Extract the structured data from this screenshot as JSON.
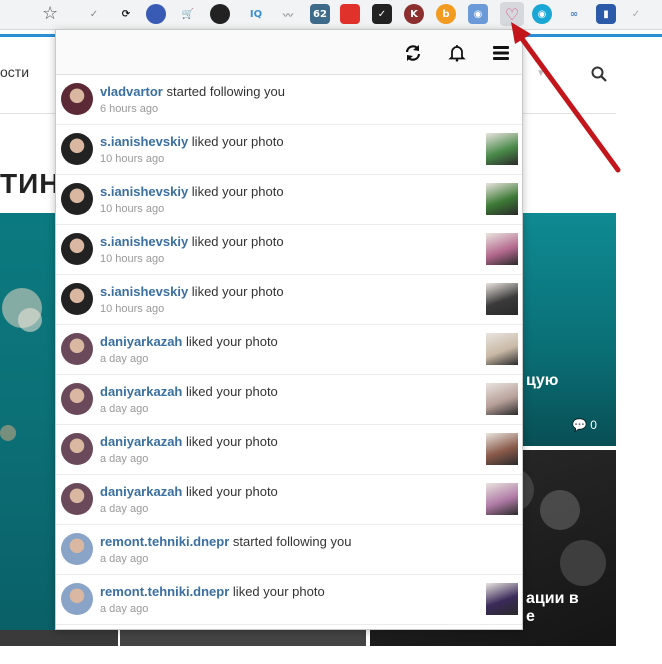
{
  "toolbar": {
    "bookmark_icon": "star-icon",
    "extensions": [
      {
        "name": "checkmark-ext-icon",
        "label": "✓",
        "bg": "#f1f3f4",
        "fg": "#888"
      },
      {
        "name": "refresh-ext-icon",
        "label": "⟳",
        "bg": "#f1f3f4",
        "fg": "#111"
      },
      {
        "name": "circle-ext-icon",
        "label": "",
        "bg": "#3a5bb5",
        "fg": "#fff"
      },
      {
        "name": "cart-ext-icon",
        "label": "🛒",
        "bg": "#f1f3f4",
        "fg": "#d22"
      },
      {
        "name": "dial-ext-icon",
        "label": "",
        "bg": "#222",
        "fg": "#fff"
      },
      {
        "name": "iq-ext-icon",
        "label": "IQ",
        "bg": "#f1f3f4",
        "fg": "#3a8ed6"
      },
      {
        "name": "wave-ext-icon",
        "label": "〰",
        "bg": "#f1f3f4",
        "fg": "#999"
      },
      {
        "name": "counter-ext-icon",
        "label": "62",
        "bg": "#3f6b8a",
        "fg": "#fff"
      },
      {
        "name": "flag-ext-icon",
        "label": "",
        "bg": "#e0312a",
        "fg": "#ffd400"
      },
      {
        "name": "task-ext-icon",
        "label": "✓",
        "bg": "#222",
        "fg": "#fff"
      },
      {
        "name": "k-ext-icon",
        "label": "K",
        "bg": "#8b2f2f",
        "fg": "#fff"
      },
      {
        "name": "b-ext-icon",
        "label": "b",
        "bg": "#f39a20",
        "fg": "#fff"
      },
      {
        "name": "rss-ext-icon",
        "label": "◉",
        "bg": "#6a9bd8",
        "fg": "#fff"
      },
      {
        "name": "heart-ext-icon",
        "label": "♡",
        "bg": "#d5d8dc",
        "fg": "#e44a8a"
      },
      {
        "name": "eye-ext-icon",
        "label": "◉",
        "bg": "#1aa7d6",
        "fg": "#fff"
      },
      {
        "name": "link-ext-icon",
        "label": "∞",
        "bg": "#f1f3f4",
        "fg": "#4a7fc0"
      },
      {
        "name": "bookmark-ext-icon",
        "label": "▮",
        "bg": "#2b5aa8",
        "fg": "#fff"
      },
      {
        "name": "tick-ext-icon",
        "label": "✓",
        "bg": "#f1f3f4",
        "fg": "#aaa"
      }
    ]
  },
  "background_page": {
    "nav_partial": "ости",
    "heading_partial": "ТИН",
    "card_right_partial": "цую",
    "card_right_comments": "0",
    "card_right_bottom_partial": "ации в",
    "card_right_bottom_partial2": "е",
    "accent": "#2b8fd6"
  },
  "popup": {
    "header_icons": [
      "refresh-icon",
      "bell-icon",
      "menu-icon"
    ],
    "notifications": [
      {
        "user": "vladvartor",
        "action": "started following you",
        "time": "6 hours ago",
        "has_thumb": false,
        "avatar_color": "#5b2a36",
        "thumb_color": ""
      },
      {
        "user": "s.ianishevskiy",
        "action": "liked your photo",
        "time": "10 hours ago",
        "has_thumb": true,
        "avatar_color": "#222222",
        "thumb_color": "#4a8a4a"
      },
      {
        "user": "s.ianishevskiy",
        "action": "liked your photo",
        "time": "10 hours ago",
        "has_thumb": true,
        "avatar_color": "#222222",
        "thumb_color": "#3d7a36"
      },
      {
        "user": "s.ianishevskiy",
        "action": "liked your photo",
        "time": "10 hours ago",
        "has_thumb": true,
        "avatar_color": "#222222",
        "thumb_color": "#b56a8f"
      },
      {
        "user": "s.ianishevskiy",
        "action": "liked your photo",
        "time": "10 hours ago",
        "has_thumb": true,
        "avatar_color": "#222222",
        "thumb_color": "#3a3a3a"
      },
      {
        "user": "daniyarkazah",
        "action": "liked your photo",
        "time": "a day ago",
        "has_thumb": true,
        "avatar_color": "#6a4a5a",
        "thumb_color": "#c9b9a6"
      },
      {
        "user": "daniyarkazah",
        "action": "liked your photo",
        "time": "a day ago",
        "has_thumb": true,
        "avatar_color": "#6a4a5a",
        "thumb_color": "#b8a09a"
      },
      {
        "user": "daniyarkazah",
        "action": "liked your photo",
        "time": "a day ago",
        "has_thumb": true,
        "avatar_color": "#6a4a5a",
        "thumb_color": "#8a5a4a"
      },
      {
        "user": "daniyarkazah",
        "action": "liked your photo",
        "time": "a day ago",
        "has_thumb": true,
        "avatar_color": "#6a4a5a",
        "thumb_color": "#b07aa6"
      },
      {
        "user": "remont.tehniki.dnepr",
        "action": "started following you",
        "time": "a day ago",
        "has_thumb": false,
        "avatar_color": "#8aa4c8",
        "thumb_color": ""
      },
      {
        "user": "remont.tehniki.dnepr",
        "action": "liked your photo",
        "time": "a day ago",
        "has_thumb": true,
        "avatar_color": "#8aa4c8",
        "thumb_color": "#3a2a5a"
      }
    ]
  }
}
